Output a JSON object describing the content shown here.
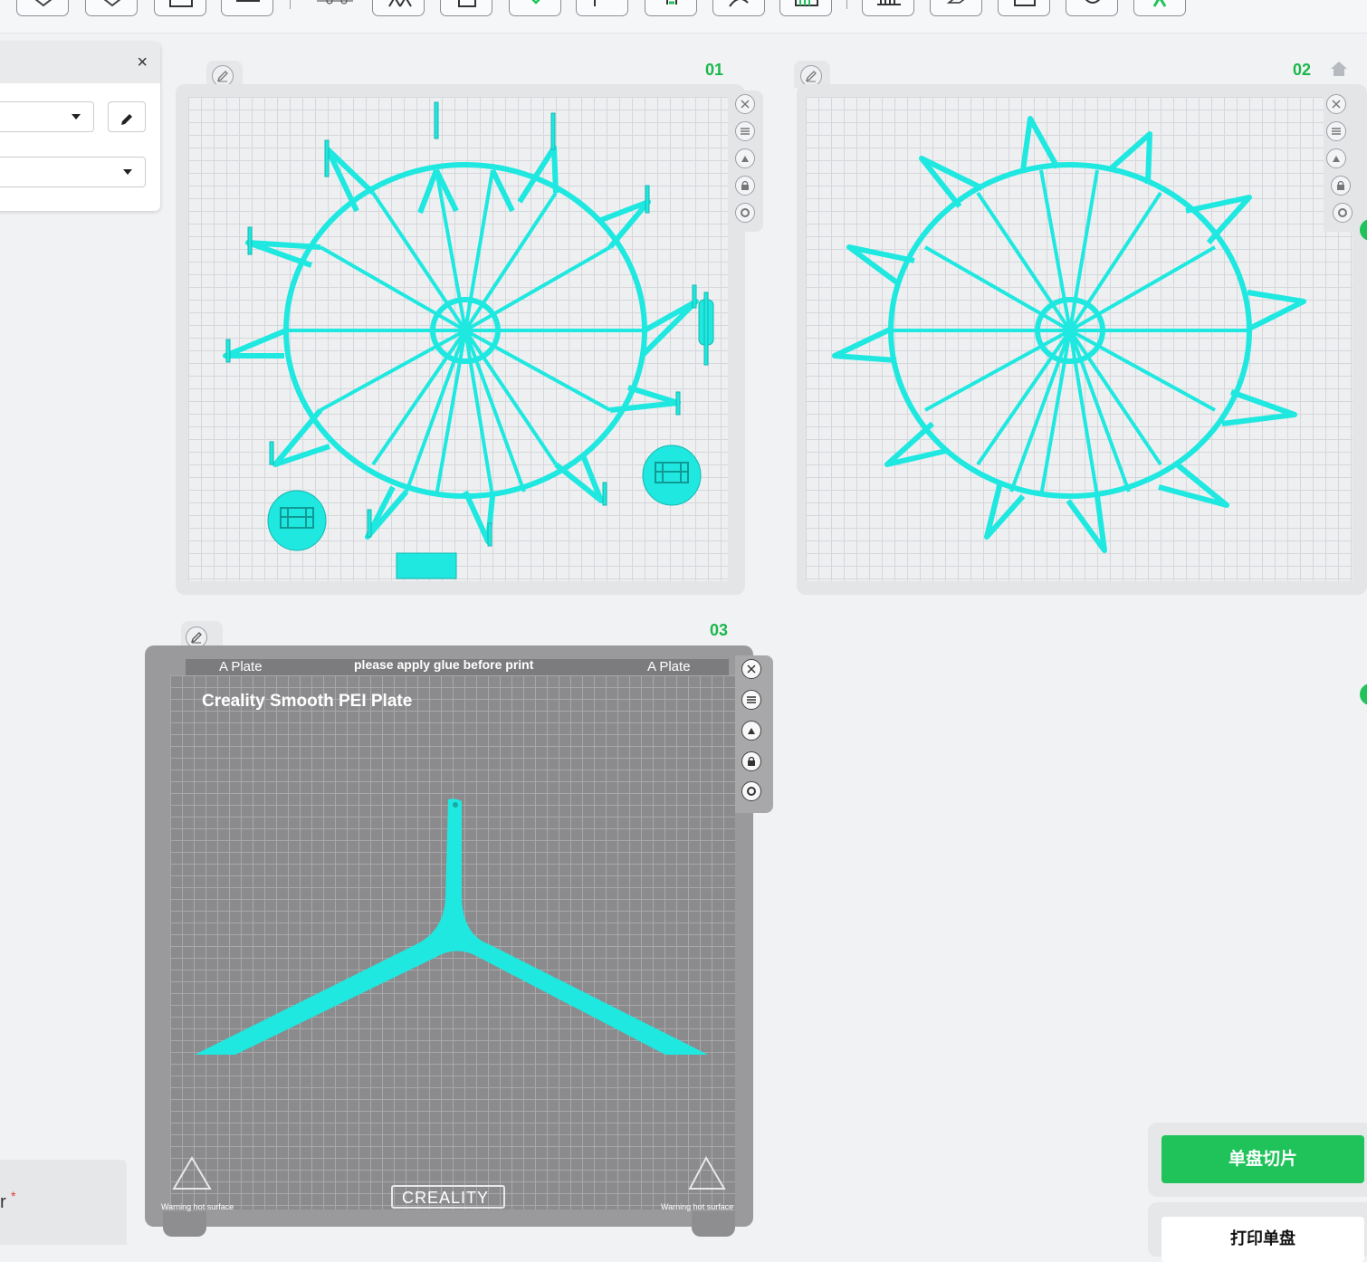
{
  "toolbar": {
    "buttons": [
      "add-icon",
      "import-icon",
      "view-icon",
      "layout-icon",
      "pick-icon",
      "arrange-icon",
      "plate-icon",
      "cube-icon",
      "cut-icon",
      "support-icon",
      "paint-icon",
      "seam-icon",
      "measure-icon",
      "text-icon",
      "assemble-icon",
      "rotate-icon",
      "more-icon"
    ]
  },
  "panel": {
    "close_label": "×",
    "required_suffix": "r",
    "required_mark": "*"
  },
  "plates": [
    {
      "number": "01"
    },
    {
      "number": "02"
    },
    {
      "number": "03"
    }
  ],
  "plate3": {
    "tab_left": "A Plate",
    "tab_center": "please apply glue before print",
    "tab_right": "A Plate",
    "surface_name": "Creality Smooth PEI Plate",
    "brand": "CREALITY",
    "warning_left": "Warning hot surface",
    "warning_right": "Warning hot surface"
  },
  "actions": {
    "slice_single": "单盘切片",
    "print_single": "打印单盘"
  },
  "colors": {
    "model": "#1ee8e0",
    "accent": "#1fc35a",
    "plate_number": "#19b84b"
  }
}
